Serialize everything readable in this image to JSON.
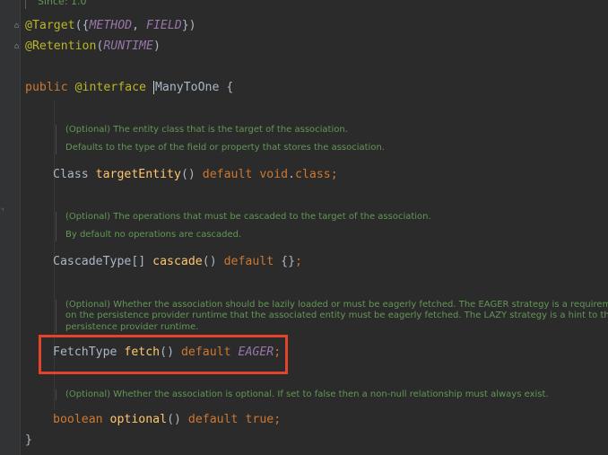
{
  "since_text": "Since: 1.0",
  "lines": {
    "target_ann": "@Target",
    "target_open": "({",
    "target_method": "METHOD",
    "target_sep": ", ",
    "target_field": "FIELD",
    "target_close": "})",
    "retention_ann": "@Retention",
    "retention_open": "(",
    "retention_value": "RUNTIME",
    "retention_close": ")",
    "public_kw": "public",
    "interface_kw": "@interface",
    "interface_name": "ManyToOne",
    "open_brace": "{",
    "close_brace": "}"
  },
  "members": [
    {
      "doc": [
        "(Optional) The entity class that is the target of the association.",
        "Defaults to the type of the field or property that stores the association."
      ],
      "type": "Class",
      "name": "targetEntity",
      "parens": "()",
      "default_kw": "default",
      "value": "void",
      "value_suffix": ".",
      "value_kw": "class",
      "semicolon": ";"
    },
    {
      "doc": [
        "(Optional) The operations that must be cascaded to the target of the association.",
        "By default no operations are cascaded."
      ],
      "type": "CascadeType[]",
      "name": "cascade",
      "parens": "()",
      "default_kw": "default",
      "value": "{}",
      "semicolon": ";"
    },
    {
      "doc": [
        "(Optional) Whether the association should be lazily loaded or must be eagerly fetched. The EAGER strategy is a requirement",
        "on the persistence provider runtime that the associated entity must be eagerly fetched. The LAZY strategy is a hint to the",
        "persistence provider runtime."
      ],
      "type": "FetchType",
      "name": "fetch",
      "parens": "()",
      "default_kw": "default",
      "value": "EAGER",
      "semicolon": ";"
    },
    {
      "doc": [
        "(Optional) Whether the association is optional. If set to false then a non-null relationship must always exist."
      ],
      "type": "boolean",
      "name": "optional",
      "parens": "()",
      "default_kw": "default",
      "value": "true",
      "semicolon": ";"
    }
  ],
  "colors": {
    "background": "#2b2b2b",
    "annotation": "#bbb529",
    "keyword": "#cc7832",
    "constant": "#9876aa",
    "method": "#ffc66d",
    "doc": "#629755",
    "highlight_box": "#e2432a"
  },
  "icons": [
    "fold-icon",
    "gutter-marker-icon"
  ]
}
